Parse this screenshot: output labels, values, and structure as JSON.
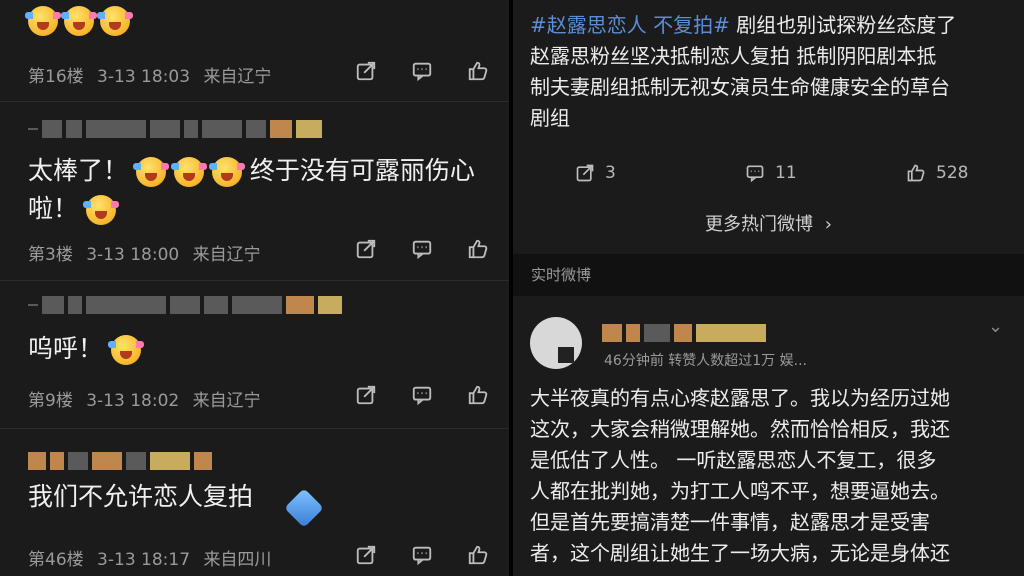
{
  "left": {
    "comments": [
      {
        "floor": "第16楼",
        "date": "3-13 18:03",
        "location": "来自辽宁"
      },
      {
        "text_a": "太棒了！",
        "text_b": "终于没有可露丽伤心",
        "text_c": "啦！",
        "floor": "第3楼",
        "date": "3-13 18:00",
        "location": "来自辽宁"
      },
      {
        "text_a": "呜呼！",
        "floor": "第9楼",
        "date": "3-13 18:02",
        "location": "来自辽宁"
      },
      {
        "text_a": "我们不允许恋人复拍",
        "floor": "第46楼",
        "date": "3-13 18:17",
        "location": "来自四川"
      }
    ],
    "icons": [
      "share-icon",
      "comment-icon",
      "like-icon"
    ]
  },
  "right": {
    "post": {
      "hashtag": "#赵露思恋人 不复拍#",
      "line1_rest": " 剧组也别试探粉丝态度了",
      "line2": "赵露思粉丝坚决抵制恋人复拍 抵制阴阳剧本抵",
      "line3": "制夫妻剧组抵制无视女演员生命健康安全的草台",
      "line4": "剧组",
      "share_count": "3",
      "comment_count": "11",
      "like_count": "528"
    },
    "more_label": "更多热门微博",
    "section_label": "实时微博",
    "realtime": {
      "meta": "46分钟前 转赞人数超过1万  娱...",
      "lines": [
        "大半夜真的有点心疼赵露思了。我以为经历过她",
        "这次，大家会稍微理解她。然而恰恰相反，我还",
        "是低估了人性。  一听赵露思恋人不复工，很多",
        "人都在批判她，为打工人鸣不平，想要逼她去。",
        "但是首先要搞清楚一件事情，赵露思才是受害",
        "者，这个剧组让她生了一场大病，无论是身体还"
      ]
    }
  }
}
